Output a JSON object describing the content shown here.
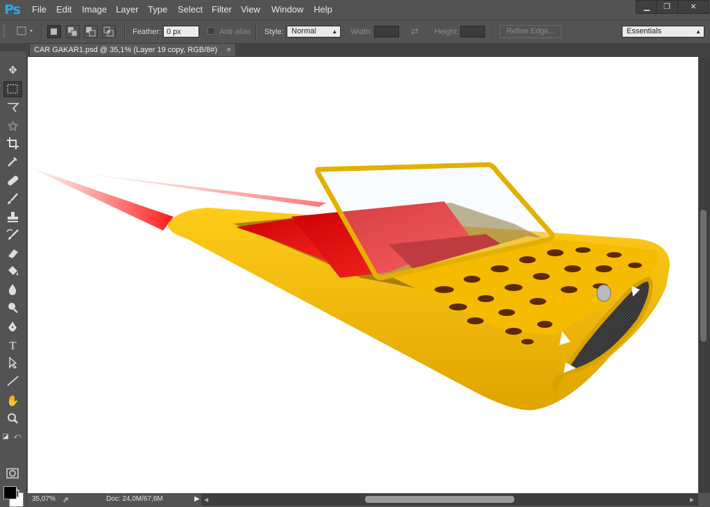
{
  "app": {
    "logo": "Ps"
  },
  "menu": [
    "File",
    "Edit",
    "Image",
    "Layer",
    "Type",
    "Select",
    "Filter",
    "View",
    "Window",
    "Help"
  ],
  "window_controls": {
    "minimize": "▁",
    "restore": "❐",
    "close": "✕"
  },
  "options": {
    "feather_label": "Feather:",
    "feather_value": "0 px",
    "antialias_label": "Anti-alias",
    "style_label": "Style:",
    "style_value": "Normal",
    "width_label": "Width:",
    "height_label": "Height:",
    "refine_edge": "Refine Edge...",
    "workspace": "Essentials"
  },
  "document_tab": {
    "title": "CAR GAKAR1.psd @ 35,1% (Layer 19 copy, RGB/8#)",
    "close": "×"
  },
  "tools": [
    "move-tool",
    "marquee-tool",
    "lasso-tool",
    "magic-wand-tool",
    "crop-tool",
    "eyedropper-tool",
    "healing-tool",
    "brush-tool",
    "stamp-tool",
    "history-brush-tool",
    "eraser-tool",
    "paint-bucket-tool",
    "blur-tool",
    "dodge-tool",
    "pen-tool",
    "type-tool",
    "path-selection-tool",
    "line-tool",
    "hand-tool",
    "zoom-tool"
  ],
  "colors": {
    "foreground": "#000000",
    "background": "#ffffff",
    "car_body": "#f2b600",
    "seat": "#d40000"
  },
  "status": {
    "zoom": "35,07%",
    "doc": "Doc: 24,0M/67,6M"
  }
}
